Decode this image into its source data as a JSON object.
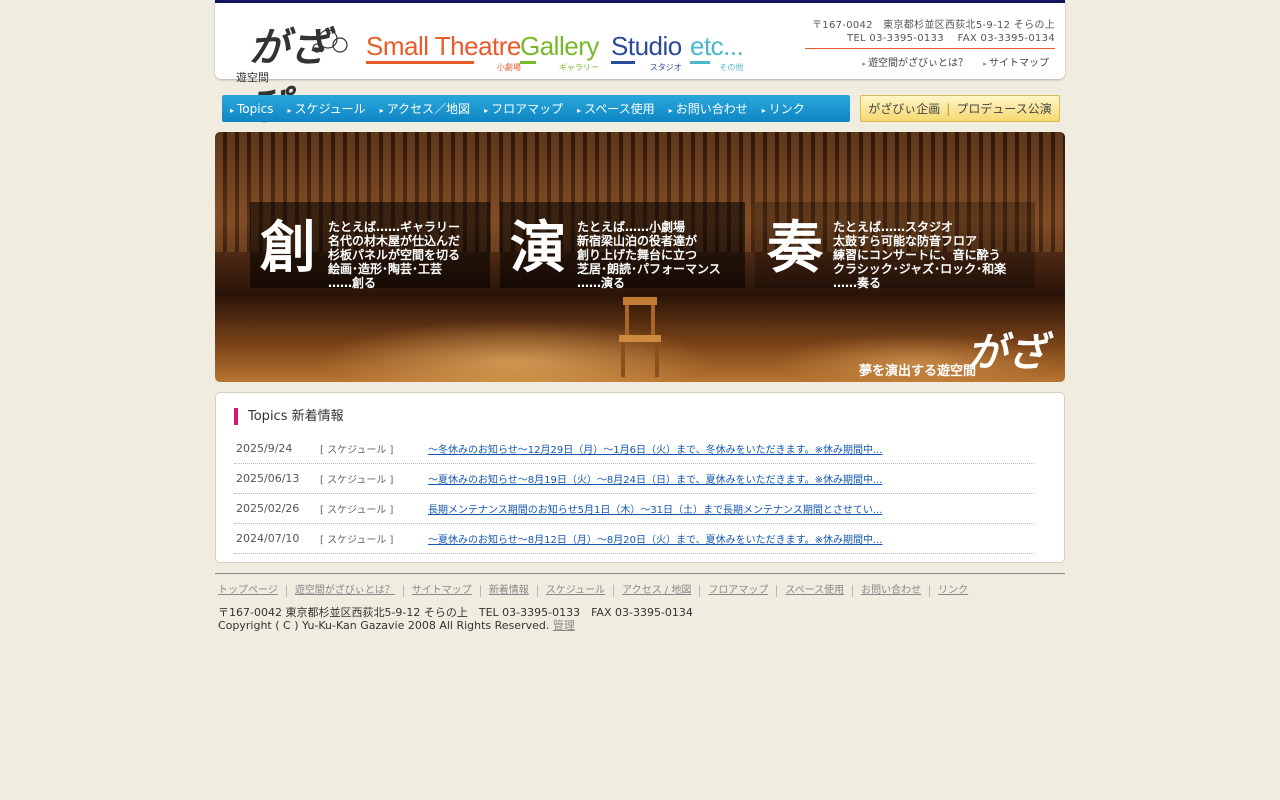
{
  "header": {
    "logo_sub": "遊空間",
    "logo_mark": "がざぴ",
    "categories": [
      {
        "en": "Small Theatre",
        "jp": "小劇場"
      },
      {
        "en": "Gallery",
        "jp": "ギャラリー"
      },
      {
        "en": "Studio",
        "jp": "スタジオ"
      },
      {
        "en": "etc...",
        "jp": "その他"
      }
    ],
    "address": "〒167-0042　東京都杉並区西荻北5-9-12 そらの上",
    "phone": "TEL 03-3395-0133　 FAX 03-3395-0134",
    "links": [
      "遊空間がざびぃとは？",
      "サイトマップ"
    ]
  },
  "nav": {
    "items": [
      "Topics",
      "スケジュール",
      "アクセス／地図",
      "フロアマップ",
      "スペース使用",
      "お問い合わせ",
      "リンク"
    ],
    "produce_a": "がざびぃ企画",
    "produce_b": "プロデュース公演"
  },
  "hero": {
    "blocks": [
      {
        "kanji": "創",
        "text": "たとえば……ギャラリー\n名代の材木屋が仕込んだ\n杉板パネルが空間を切る\n絵画･造形･陶芸･工芸\n……創る"
      },
      {
        "kanji": "演",
        "text": "たとえば……小劇場\n新宿梁山泊の役者達が\n創り上げた舞台に立つ\n芝居･朗読･パフォーマンス\n……演る"
      },
      {
        "kanji": "奏",
        "text": "たとえば……スタジオ\n太鼓すら可能な防音フロア\n練習にコンサートに、音に酔う\nクラシック･ジャズ･ロック･和楽\n……奏る"
      }
    ],
    "tagline": "夢を演出する遊空間",
    "logo": "がざぴ"
  },
  "topics": {
    "title": "Topics 新着情報",
    "items": [
      {
        "date": "2025/9/24",
        "category": "[ スケジュール ]",
        "text": "～冬休みのお知らせ～12月29日（月）～1月6日（火）まで、冬休みをいただきます。※休み期間中..."
      },
      {
        "date": "2025/06/13",
        "category": "[ スケジュール ]",
        "text": "～夏休みのお知らせ～8月19日（火）～8月24日（日）まで、夏休みをいただきます。※休み期間中..."
      },
      {
        "date": "2025/02/26",
        "category": "[ スケジュール ]",
        "text": "長期メンテナンス期間のお知らせ5月1日（木）～31日（土）まで長期メンテナンス期間とさせてい..."
      },
      {
        "date": "2024/07/10",
        "category": "[ スケジュール ]",
        "text": "～夏休みのお知らせ～8月12日（月）～8月20日（火）まで、夏休みをいただきます。※休み期間中..."
      }
    ]
  },
  "footer": {
    "links": [
      "トップページ",
      "遊空間がざびぃとは？",
      "サイトマップ",
      "新着情報",
      "スケジュール",
      "アクセス / 地図",
      "フロアマップ",
      "スペース使用",
      "お問い合わせ",
      "リンク"
    ],
    "address": "〒167-0042 東京都杉並区西荻北5-9-12 そらの上　TEL 03-3395-0133　FAX 03-3395-0134",
    "copyright": "Copyright ( C ) Yu-Ku-Kan Gazavie 2008 All Rights Reserved. ",
    "admin": "管理"
  }
}
